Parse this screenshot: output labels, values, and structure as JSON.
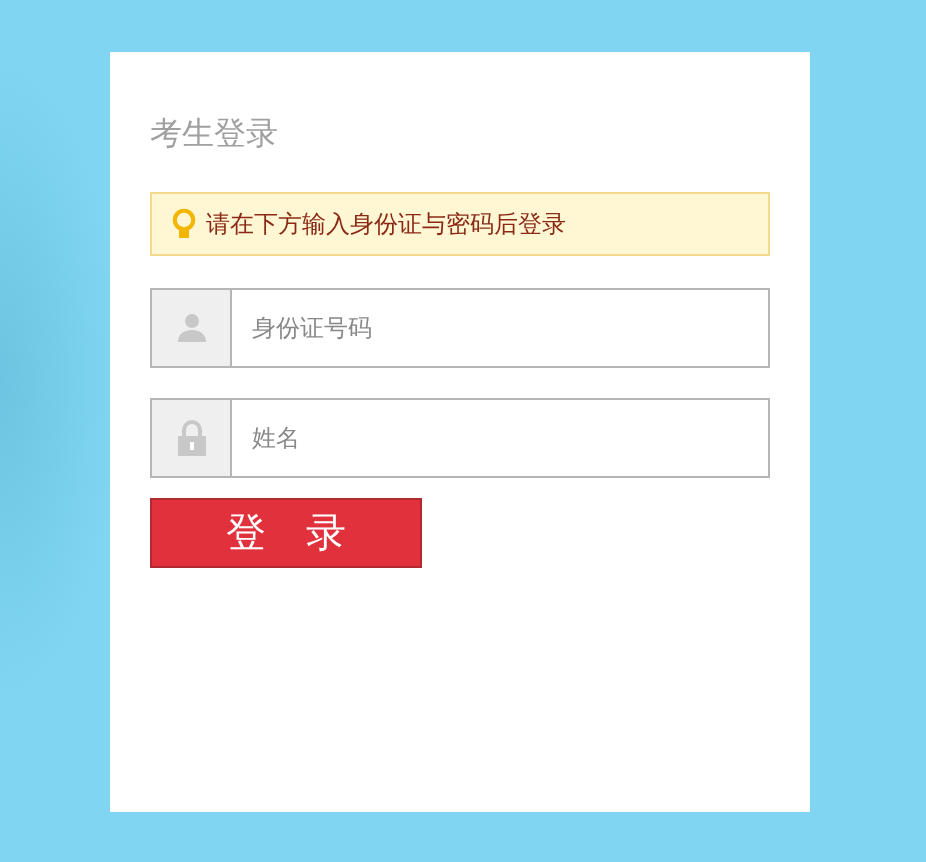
{
  "title": "考生登录",
  "notice": "请在下方输入身份证与密码后登录",
  "fields": [
    {
      "kind": "user",
      "placeholder": "身份证号码"
    },
    {
      "kind": "lock",
      "placeholder": "姓名"
    }
  ],
  "button": "登 录"
}
